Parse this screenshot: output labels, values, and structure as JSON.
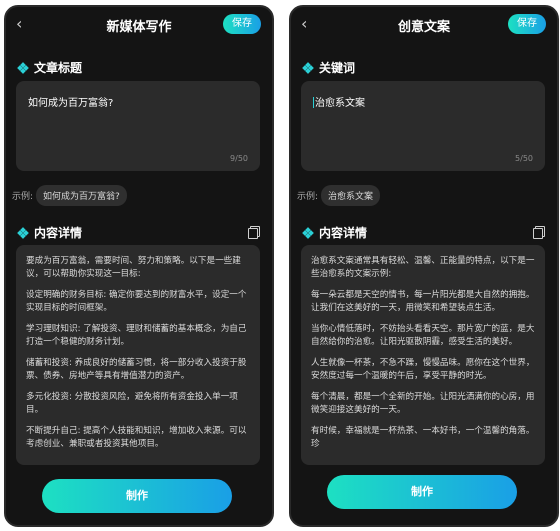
{
  "left": {
    "title": "新媒体写作",
    "back": "‹",
    "save_label": "保存",
    "section_title": "文章标题",
    "input_value": "如何成为百万富翁?",
    "counter": "9/50",
    "example_label": "示例:",
    "example_chip": "如何成为百万富翁?",
    "content_title": "内容详情",
    "paragraphs": [
      "要成为百万富翁，需要时间、努力和策略。以下是一些建议，可以帮助你实现这一目标:",
      "设定明确的财务目标: 确定你要达到的财富水平，设定一个实现目标的时间框架。",
      "学习理财知识: 了解投资、理财和储蓄的基本概念，为自己打造一个稳健的财务计划。",
      "储蓄和投资: 养成良好的储蓄习惯，将一部分收入投资于股票、债券、房地产等具有增值潜力的资产。",
      "多元化投资: 分散投资风险，避免将所有资金投入单一项目。",
      "不断提升自己: 提高个人技能和知识，增加收入来源。可以考虑创业、兼职或者投资其他项目。"
    ],
    "make_label": "制作"
  },
  "right": {
    "title": "创意文案",
    "back": "‹",
    "save_label": "保存",
    "section_title": "关键词",
    "input_value": "治愈系文案",
    "counter": "5/50",
    "example_label": "示例:",
    "example_chip": "治愈系文案",
    "content_title": "内容详情",
    "paragraphs": [
      "治愈系文案通常具有轻松、温馨、正能量的特点，以下是一些治愈系的文案示例:",
      "每一朵云都是天空的情书，每一片阳光都是大自然的拥抱。让我们在这美好的一天，用微笑和希望装点生活。",
      "当你心情低落时，不妨抬头看看天空。那片宽广的蓝，是大自然给你的治愈。让阳光驱散阴霾，感受生活的美好。",
      "人生就像一杯茶，不急不躁，慢慢品味。愿你在这个世界，安然度过每一个温暖的午后，享受平静的时光。",
      "每个清晨，都是一个全新的开始。让阳光洒满你的心房，用微笑迎接这美好的一天。",
      "有时候，幸福就是一杯热茶、一本好书，一个温馨的角落。珍"
    ],
    "make_label": "制作"
  }
}
